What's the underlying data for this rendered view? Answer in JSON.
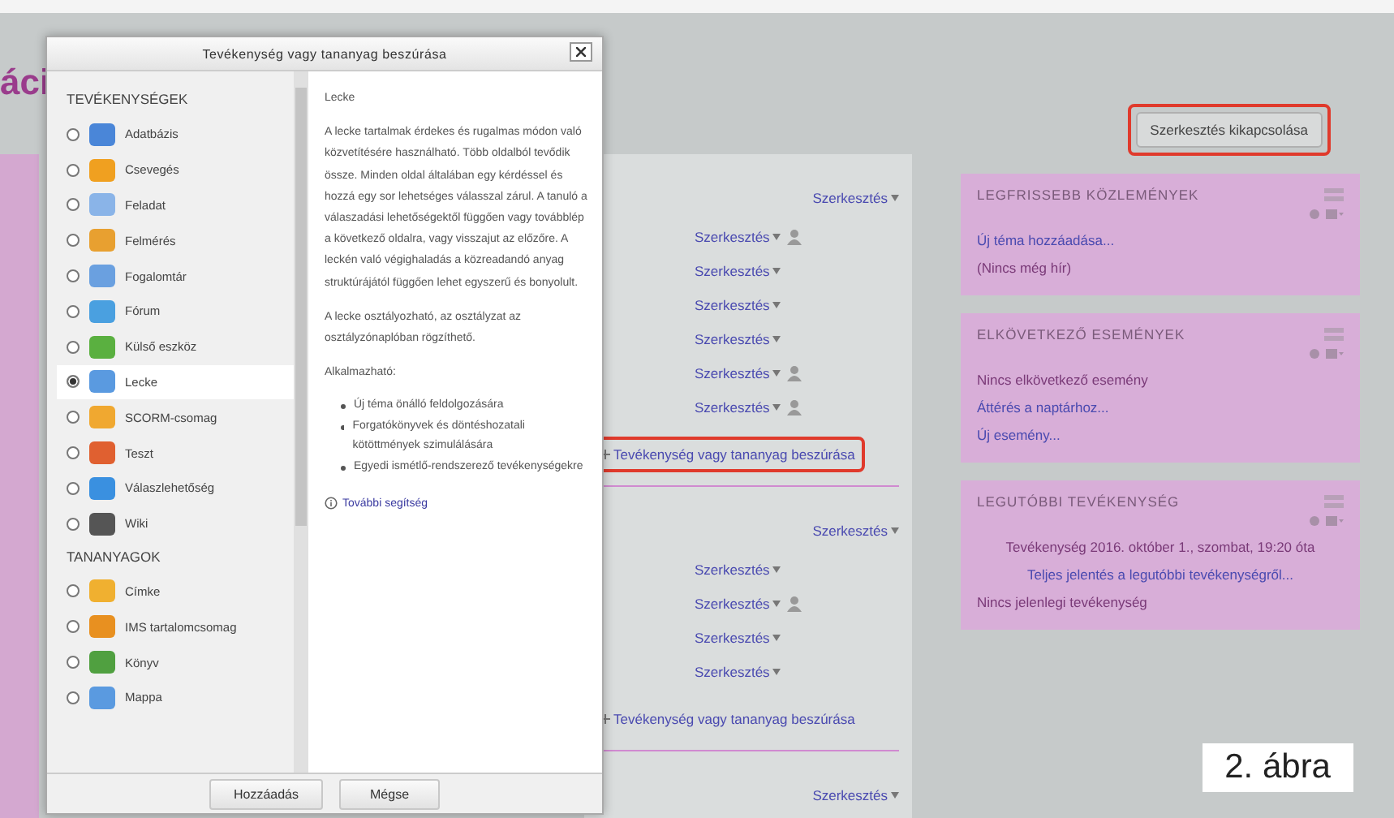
{
  "page": {
    "heading": "áci"
  },
  "edit_toggle": {
    "label": "Szerkesztés kikapcsolása",
    "highlighted": true
  },
  "sections": [
    {
      "header_edit": "Szerkesztés",
      "items": [
        {
          "edit": "Szerkesztés",
          "person_icon": true
        },
        {
          "edit": "Szerkesztés",
          "person_icon": false
        },
        {
          "edit": "Szerkesztés",
          "person_icon": false
        },
        {
          "edit": "Szerkesztés",
          "person_icon": false
        },
        {
          "edit": "Szerkesztés",
          "person_icon": true
        },
        {
          "edit": "Szerkesztés",
          "person_icon": true
        }
      ],
      "add_link": "Tevékenység vagy tananyag beszúrása",
      "highlighted": true
    },
    {
      "header_edit": "Szerkesztés",
      "items": [
        {
          "edit": "Szerkesztés",
          "person_icon": false
        },
        {
          "edit": "Szerkesztés",
          "person_icon": true
        },
        {
          "edit": "Szerkesztés",
          "person_icon": false
        },
        {
          "edit": "Szerkesztés",
          "person_icon": false
        }
      ],
      "add_link": "Tevékenység vagy tananyag beszúrása",
      "highlighted": false
    }
  ],
  "last_edit": "Szerkesztés",
  "blocks": [
    {
      "title": "LEGFRISSEBB KÖZLEMÉNYEK",
      "lines": [
        {
          "kind": "link",
          "text": "Új téma hozzáadása..."
        },
        {
          "kind": "text",
          "text": "(Nincs még hír)"
        }
      ]
    },
    {
      "title": "ELKÖVETKEZŐ ESEMÉNYEK",
      "lines": [
        {
          "kind": "text",
          "text": "Nincs elkövetkező esemény"
        },
        {
          "kind": "link",
          "text": "Áttérés a naptárhoz..."
        },
        {
          "kind": "link",
          "text": "Új esemény..."
        }
      ]
    },
    {
      "title": "LEGUTÓBBI TEVÉKENYSÉG",
      "lines": [
        {
          "kind": "center_text",
          "text": "Tevékenység 2016. október 1., szombat, 19:20 óta"
        },
        {
          "kind": "center_link",
          "text": "Teljes jelentés a legutóbbi tevékenységről..."
        },
        {
          "kind": "text",
          "text": "Nincs jelenlegi tevékenység"
        }
      ]
    }
  ],
  "dialog": {
    "title": "Tevékenység vagy tananyag beszúrása",
    "groups": [
      {
        "heading": "TEVÉKENYSÉGEK",
        "items": [
          {
            "label": "Adatbázis",
            "selected": false,
            "color": "#4a86d8"
          },
          {
            "label": "Csevegés",
            "selected": false,
            "color": "#f0a020"
          },
          {
            "label": "Feladat",
            "selected": false,
            "color": "#8ab4e8"
          },
          {
            "label": "Felmérés",
            "selected": false,
            "color": "#e8a030"
          },
          {
            "label": "Fogalomtár",
            "selected": false,
            "color": "#6aa0e0"
          },
          {
            "label": "Fórum",
            "selected": false,
            "color": "#4aa0e0"
          },
          {
            "label": "Külső eszköz",
            "selected": false,
            "color": "#5ab040"
          },
          {
            "label": "Lecke",
            "selected": true,
            "color": "#5a9ae0"
          },
          {
            "label": "SCORM-csomag",
            "selected": false,
            "color": "#f0a830"
          },
          {
            "label": "Teszt",
            "selected": false,
            "color": "#e06030"
          },
          {
            "label": "Válaszlehetőség",
            "selected": false,
            "color": "#3a90e0"
          },
          {
            "label": "Wiki",
            "selected": false,
            "color": "#555555"
          }
        ]
      },
      {
        "heading": "TANANYAGOK",
        "items": [
          {
            "label": "Címke",
            "selected": false,
            "color": "#f0b030"
          },
          {
            "label": "IMS tartalomcsomag",
            "selected": false,
            "color": "#e89020"
          },
          {
            "label": "Könyv",
            "selected": false,
            "color": "#50a040"
          },
          {
            "label": "Mappa",
            "selected": false,
            "color": "#5a9ae0"
          }
        ]
      }
    ],
    "description": {
      "title": "Lecke",
      "paragraphs": [
        "A lecke tartalmak érdekes és rugalmas módon való közvetítésére használható. Több oldalból tevődik össze. Minden oldal általában egy kérdéssel és hozzá egy sor lehetséges válasszal zárul. A tanuló a válaszadási lehetőségektől függően vagy továbblép a következő oldalra, vagy visszajut az előzőre. A leckén való végighaladás a közreadandó anyag struktúrájától függően lehet egyszerű és bonyolult.",
        "A lecke osztályozható, az osztályzat az osztályzónaplóban rögzíthető."
      ],
      "usage_heading": "Alkalmazható:",
      "bullets": [
        "Új téma önálló feldolgozására",
        "Forgatókönyvek és döntéshozatali kötöttmények szimulálására",
        "Egyedi ismétlő-rendszerező tevékenységekre"
      ],
      "help_link": "További segítség"
    },
    "buttons": [
      "Hozzáadás",
      "Mégse"
    ]
  },
  "caption": "2. ábra"
}
